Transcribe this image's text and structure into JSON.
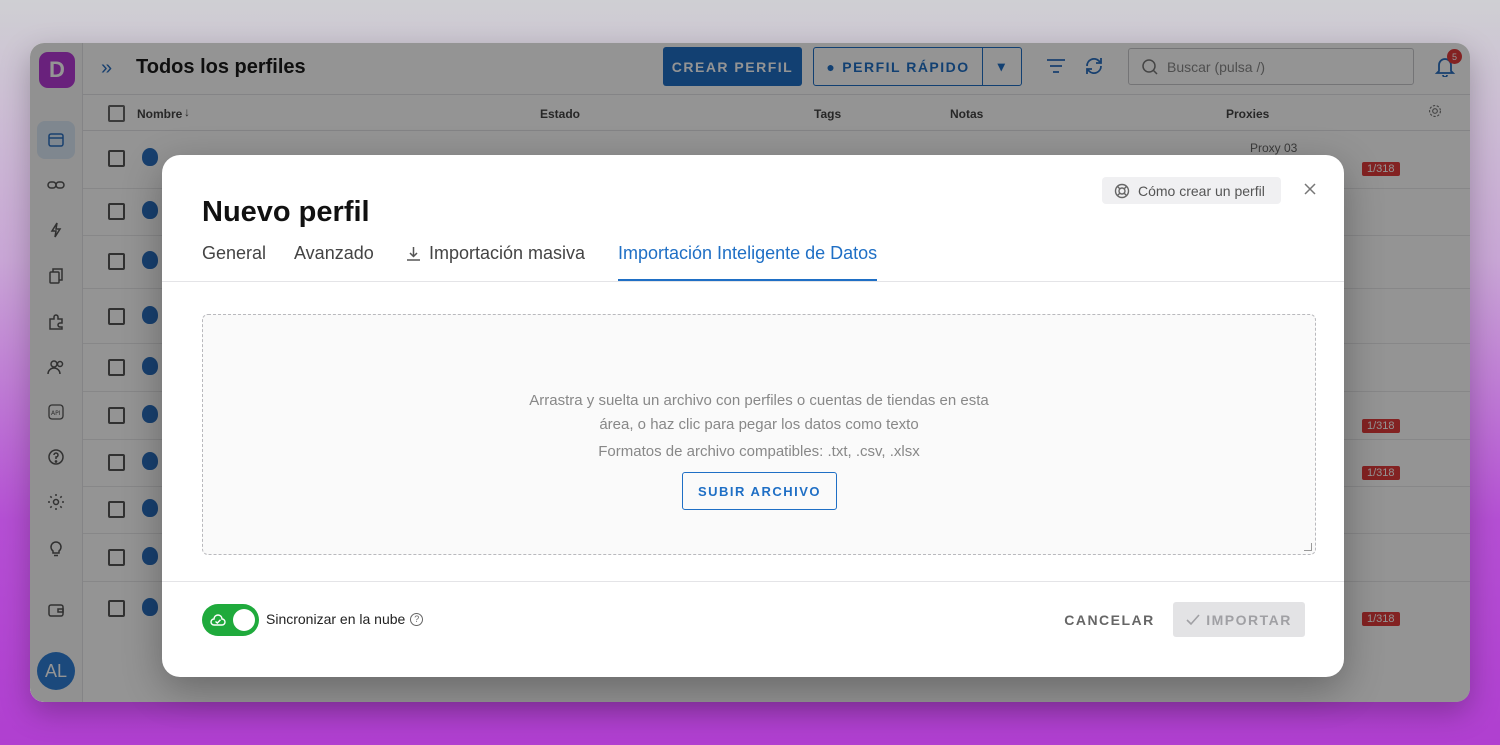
{
  "app": {
    "logo_letter": "D",
    "page_title": "Todos los perfiles",
    "avatar_initials": "AL"
  },
  "toolbar": {
    "create_label": "CREAR PERFIL",
    "quick_label": "PERFIL RÁPIDO",
    "search_placeholder": "Buscar (pulsa /)",
    "notification_count": "5"
  },
  "table": {
    "columns": {
      "name": "Nombre",
      "status": "Estado",
      "tags": "Tags",
      "notes": "Notas",
      "proxies": "Proxies"
    },
    "proxy_visible": "Proxy 03",
    "count_badge": "1/318"
  },
  "modal": {
    "title": "Nuevo perfil",
    "help_label": "Cómo crear un perfil",
    "tabs": [
      "General",
      "Avanzado",
      "Importación masiva",
      "Importación Inteligente de Datos"
    ],
    "active_tab": "Importación Inteligente de Datos",
    "dropzone": {
      "line1": "Arrastra y suelta un archivo con perfiles o cuentas de tiendas en esta",
      "line2": "área, o haz clic para pegar los datos como texto",
      "formats": "Formatos de archivo compatibles: .txt, .csv, .xlsx",
      "upload_label": "SUBIR ARCHIVO"
    },
    "footer": {
      "sync_label": "Sincronizar en la nube",
      "cancel_label": "CANCELAR",
      "import_label": "IMPORTAR"
    }
  },
  "colors": {
    "accent": "#1f6fc5",
    "toggle_on": "#1faa3c",
    "brand": "#b63ad6",
    "danger": "#e23b3b"
  }
}
